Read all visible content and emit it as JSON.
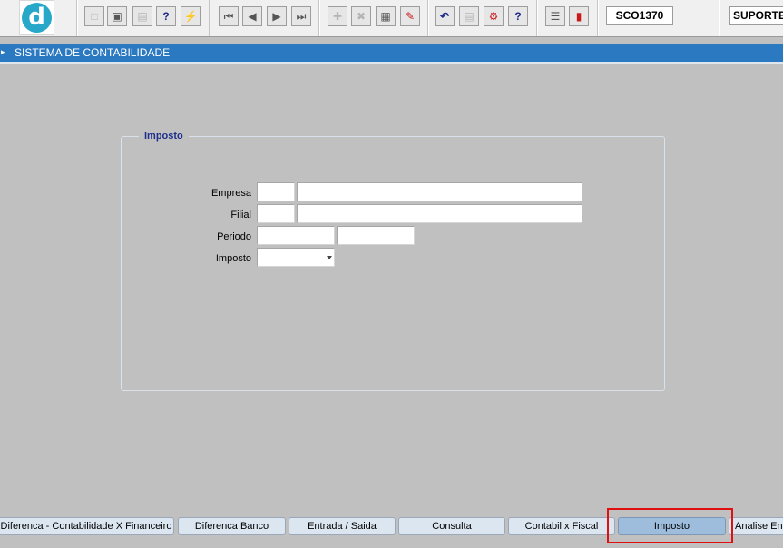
{
  "toolbar": {
    "logo_letter": "d",
    "form_id": "SCO1370",
    "user": "SUPORTE"
  },
  "titlebar": {
    "title": "SISTEMA DE CONTABILIDADE"
  },
  "panel": {
    "title": "Imposto",
    "fields": {
      "empresa": {
        "label": "Empresa",
        "code": "",
        "name": ""
      },
      "filial": {
        "label": "Filial",
        "code": "",
        "name": ""
      },
      "periodo": {
        "label": "Periodo",
        "start": "",
        "end": ""
      },
      "imposto": {
        "label": "Imposto",
        "selected": ""
      }
    }
  },
  "tabs": [
    {
      "label": "Diferenca - Contabilidade X Financeiro",
      "active": false
    },
    {
      "label": "Diferenca Banco",
      "active": false
    },
    {
      "label": "Entrada / Saida",
      "active": false
    },
    {
      "label": "Consulta",
      "active": false
    },
    {
      "label": "Contabil x Fiscal",
      "active": false
    },
    {
      "label": "Imposto",
      "active": true
    },
    {
      "label": "Analise Ent",
      "active": false
    }
  ],
  "highlight": {
    "color": "#e01010",
    "target": "Imposto"
  }
}
